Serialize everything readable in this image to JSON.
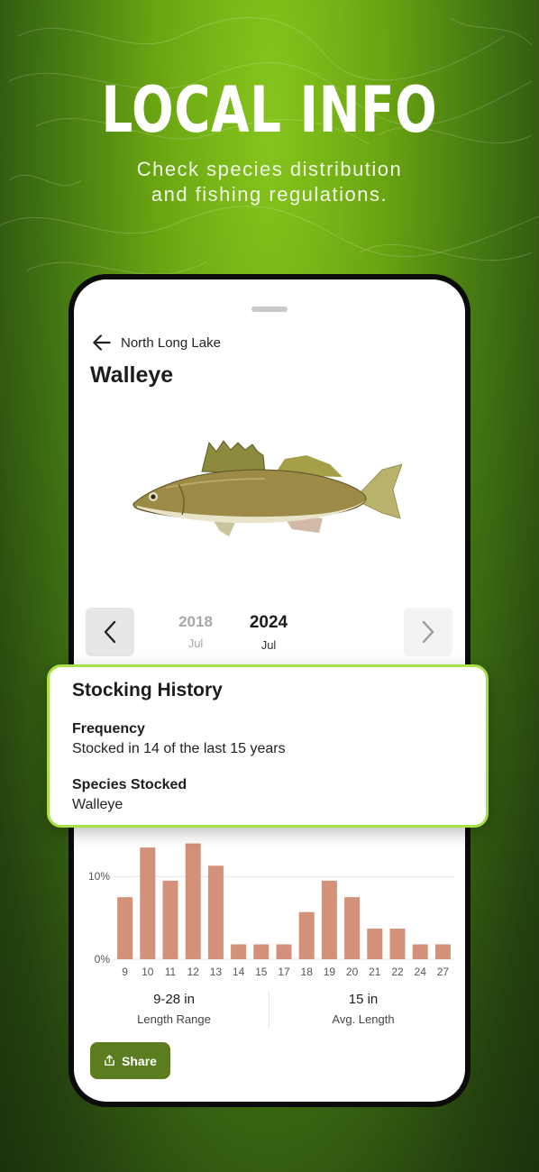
{
  "hero": {
    "title": "LOCAL INFO",
    "subtitle_line1": "Check species distribution",
    "subtitle_line2": "and fishing regulations."
  },
  "header": {
    "back_icon": "arrow-left-icon",
    "lake_name": "North Long Lake",
    "species_title": "Walleye"
  },
  "year_selector": {
    "prev_icon": "chevron-left-icon",
    "next_icon": "chevron-right-icon",
    "years": [
      {
        "year": "2018",
        "month": "Jul",
        "selected": false
      },
      {
        "year": "2024",
        "month": "Jul",
        "selected": true
      }
    ]
  },
  "stocking_card": {
    "title": "Stocking History",
    "frequency_label": "Frequency",
    "frequency_value": "Stocked in 14 of the last 15 years",
    "species_label": "Species Stocked",
    "species_value": "Walleye"
  },
  "chart_data": {
    "type": "bar",
    "categories": [
      "9",
      "10",
      "11",
      "12",
      "13",
      "14",
      "15",
      "17",
      "18",
      "19",
      "20",
      "21",
      "22",
      "24",
      "27"
    ],
    "values": [
      7.5,
      13.5,
      9.5,
      14,
      11.3,
      1.8,
      1.8,
      1.8,
      5.7,
      9.5,
      7.5,
      3.7,
      3.7,
      1.8,
      1.8
    ],
    "ytick_labels": [
      "0%",
      "10%"
    ],
    "ylim": [
      0,
      17
    ],
    "grid": true,
    "color": "#d4917a"
  },
  "stats": {
    "length_range_value": "9-28 in",
    "length_range_label": "Length Range",
    "avg_length_value": "15 in",
    "avg_length_label": "Avg. Length"
  },
  "share": {
    "icon": "share-icon",
    "label": "Share"
  },
  "colors": {
    "accent_green": "#5c7d1f",
    "card_border": "#a9e04a",
    "bar": "#d4917a"
  }
}
